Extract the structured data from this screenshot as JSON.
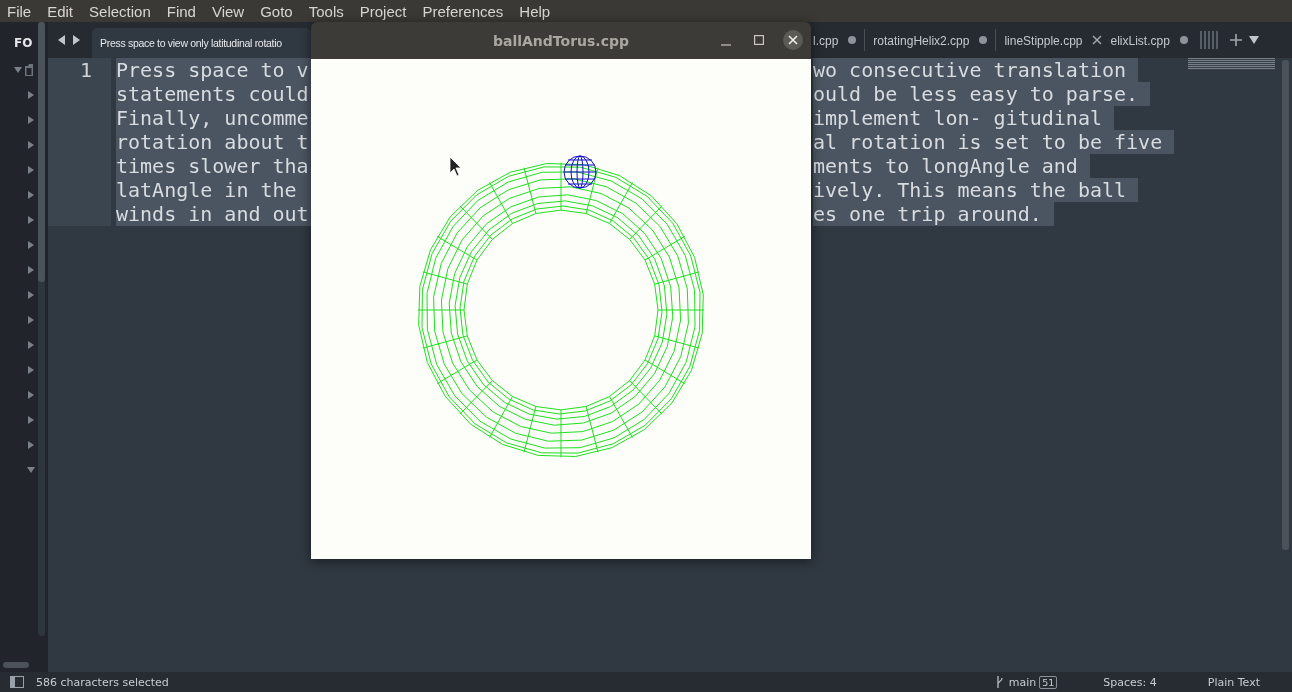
{
  "menu": [
    "File",
    "Edit",
    "Selection",
    "Find",
    "View",
    "Goto",
    "Tools",
    "Project",
    "Preferences",
    "Help"
  ],
  "sidebar": {
    "header": "FO",
    "items": [
      {
        "kind": "folder",
        "expanded": true
      },
      {
        "kind": "entry",
        "expanded": false
      },
      {
        "kind": "entry",
        "expanded": false
      },
      {
        "kind": "entry",
        "expanded": false
      },
      {
        "kind": "entry",
        "expanded": false
      },
      {
        "kind": "entry",
        "expanded": false
      },
      {
        "kind": "entry",
        "expanded": false
      },
      {
        "kind": "entry",
        "expanded": false
      },
      {
        "kind": "entry",
        "expanded": false
      },
      {
        "kind": "entry",
        "expanded": false
      },
      {
        "kind": "entry",
        "expanded": false
      },
      {
        "kind": "entry",
        "expanded": false
      },
      {
        "kind": "entry",
        "expanded": false
      },
      {
        "kind": "entry",
        "expanded": false
      },
      {
        "kind": "entry",
        "expanded": false
      },
      {
        "kind": "entry",
        "expanded": false
      },
      {
        "kind": "entry",
        "expanded": true
      }
    ]
  },
  "tabs": [
    {
      "label": "Press space to view only latitudinal rotatio",
      "selected": true
    },
    {
      "label": "l.cpp",
      "selected": false,
      "modified": true
    },
    {
      "label": "rotatingHelix2.cpp",
      "selected": false,
      "modified": true
    },
    {
      "label": "lineStipple.cpp",
      "selected": false,
      "modified": false
    },
    {
      "label": "elixList.cpp",
      "selected": false,
      "modified": true
    }
  ],
  "editor": {
    "line_number": "1",
    "lines": [
      {
        "left": "Press space to v",
        "right": "wo consecutive translation"
      },
      {
        "left": "statements could",
        "right": "ould be less easy to parse."
      },
      {
        "left": "Finally, uncomme",
        "right": "implement lon- gitudinal"
      },
      {
        "left": "rotation about t",
        "right": "al rotation is set to be five"
      },
      {
        "left": "times slower tha",
        "right": "ments to longAngle and"
      },
      {
        "left": "latAngle in the",
        "right": "ively. This means the ball"
      },
      {
        "left": "winds in and out",
        "right": "es one trip around."
      }
    ]
  },
  "window": {
    "title": "ballAndTorus.cpp"
  },
  "status_bar": {
    "selection": "586 characters selected",
    "branch": "main",
    "changes": "51",
    "indentation": "Spaces: 4",
    "syntax": "Plain Text"
  }
}
